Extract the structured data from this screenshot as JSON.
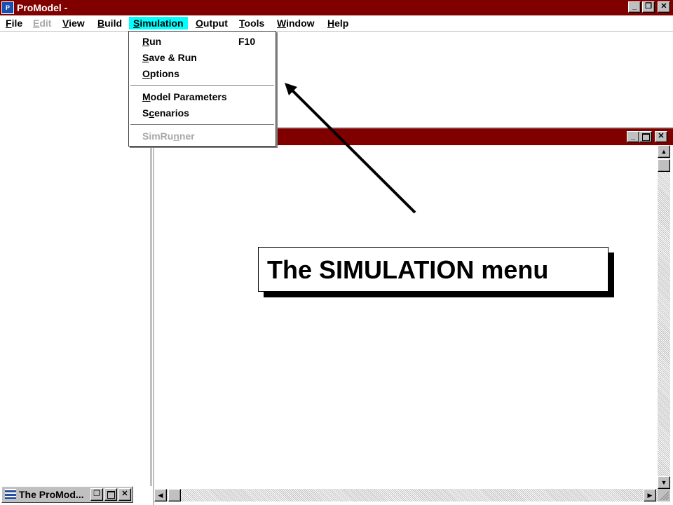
{
  "app": {
    "title": "ProModel -",
    "icon": "promodel-app-icon"
  },
  "title_buttons": {
    "minimize": "_",
    "restore": "❐",
    "close": "✕"
  },
  "menu": {
    "items": [
      {
        "label": "File",
        "mnemonic_index": 0,
        "disabled": false
      },
      {
        "label": "Edit",
        "mnemonic_index": 0,
        "disabled": true
      },
      {
        "label": "View",
        "mnemonic_index": 0,
        "disabled": false
      },
      {
        "label": "Build",
        "mnemonic_index": 0,
        "disabled": false
      },
      {
        "label": "Simulation",
        "mnemonic_index": 0,
        "disabled": false,
        "active": true
      },
      {
        "label": "Output",
        "mnemonic_index": 0,
        "disabled": false
      },
      {
        "label": "Tools",
        "mnemonic_index": 0,
        "disabled": false
      },
      {
        "label": "Window",
        "mnemonic_index": 0,
        "disabled": false
      },
      {
        "label": "Help",
        "mnemonic_index": 0,
        "disabled": false
      }
    ],
    "active_color": "#00ffff"
  },
  "simulation_menu": {
    "run": "Run",
    "run_shortcut": "F10",
    "save_run": "Save & Run",
    "options": "Options",
    "model_parameters": "Model Parameters",
    "scenarios": "Scenarios",
    "simrunner": "SimRunner"
  },
  "minimized_window": {
    "title": "The ProMod...",
    "icon": "window-grid-icon"
  },
  "callout": {
    "text": "The SIMULATION menu"
  },
  "colors": {
    "title_bar": "#800000",
    "face": "#c0c0c0",
    "disabled_text": "#a8a8a8"
  }
}
